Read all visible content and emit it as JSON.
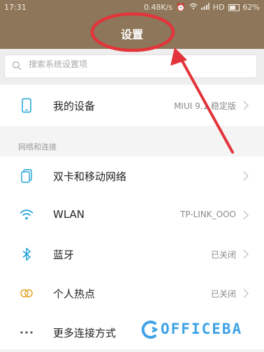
{
  "status_bar": {
    "time": "17:31",
    "speed": "0.48K/s",
    "network": "HD",
    "battery": "62%"
  },
  "header": {
    "title": "设置"
  },
  "search": {
    "placeholder": "搜索系统设置项"
  },
  "device": {
    "label": "我的设备",
    "value": "MIUI 9.1 稳定版",
    "icon": "phone-icon"
  },
  "section_title": "网络和连接",
  "network_items": [
    {
      "label": "双卡和移动网络",
      "value": "",
      "icon": "sim-cards-icon"
    },
    {
      "label": "WLAN",
      "value": "TP-LINK_OOO",
      "icon": "wifi-icon"
    },
    {
      "label": "蓝牙",
      "value": "已关闭",
      "icon": "bluetooth-icon"
    },
    {
      "label": "个人热点",
      "value": "已关闭",
      "icon": "hotspot-icon"
    },
    {
      "label": "更多连接方式",
      "value": "",
      "icon": "more-dots-icon"
    }
  ],
  "watermark": {
    "text": "OFFICEBA"
  },
  "colors": {
    "header": "#8d7659",
    "annotation": "#e2343a",
    "watermark": "#3fa2e6"
  }
}
